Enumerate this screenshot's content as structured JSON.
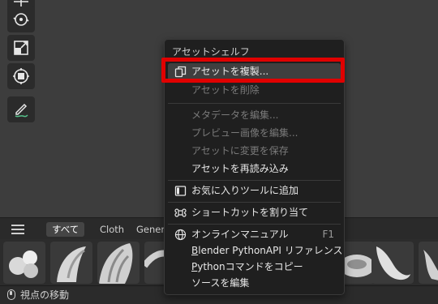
{
  "menu": {
    "title": "アセットシェルフ",
    "items": [
      {
        "label": "アセットを複製..."
      },
      {
        "label": "アセットを削除"
      },
      {
        "label": "メタデータを編集..."
      },
      {
        "label": "プレビュー画像を編集..."
      },
      {
        "label": "アセットに変更を保存"
      },
      {
        "label": "アセットを再読み込み"
      },
      {
        "label": "お気に入りツールに追加"
      },
      {
        "label": "ショートカットを割り当て"
      },
      {
        "label": "オンラインマニュアル",
        "shortcut": "F1"
      },
      {
        "label_first": "B",
        "label_rest": "lender PythonAPI リファレンス"
      },
      {
        "label_first": "P",
        "label_rest": "ythonコマンドをコピー"
      },
      {
        "label": "ソースを編集"
      }
    ]
  },
  "shelf": {
    "tabs": [
      "すべて",
      "Cloth",
      "Genera"
    ]
  },
  "status": {
    "text": "視点の移動"
  },
  "icons": {
    "duplicate": "duplicate-icon",
    "favorite": "favorite-panel-icon",
    "shortcut": "command-key-icon",
    "manual": "globe-icon"
  },
  "colors": {
    "highlight_outline": "#e00000"
  }
}
